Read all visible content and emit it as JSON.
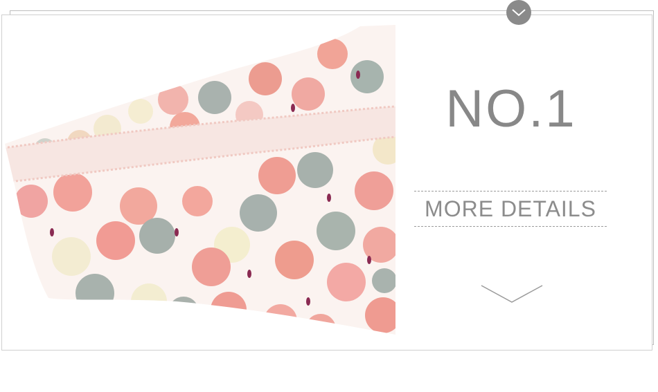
{
  "panel": {
    "title": "NO.1",
    "details_label": "MORE DETAILS"
  },
  "icons": {
    "top_badge": "chevron-down-icon",
    "bottom_arrow": "chevron-down-icon"
  },
  "photo": {
    "subject": "product-photo"
  },
  "colors": {
    "text": "#888888",
    "badge": "#8a8a8a",
    "border": "#bdbdbd"
  }
}
